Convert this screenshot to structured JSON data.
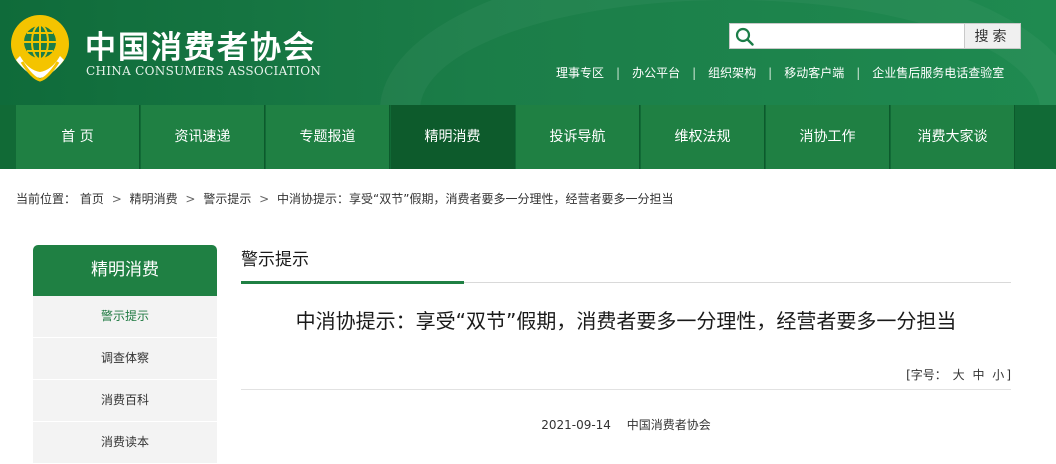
{
  "site": {
    "title": "中国消费者协会",
    "subtitle": "CHINA CONSUMERS ASSOCIATION"
  },
  "search": {
    "placeholder": "",
    "button_label": "搜索"
  },
  "top_links": [
    "理事专区",
    "办公平台",
    "组织架构",
    "移动客户端",
    "企业售后服务电话查验室"
  ],
  "nav": {
    "items": [
      "首 页",
      "资讯速递",
      "专题报道",
      "精明消费",
      "投诉导航",
      "维权法规",
      "消协工作",
      "消费大家谈"
    ],
    "active_index": 3
  },
  "breadcrumb": {
    "prefix": "当前位置：",
    "items": [
      "首页",
      "精明消费",
      "警示提示",
      "中消协提示：享受“双节”假期，消费者要多一分理性，经营者要多一分担当"
    ]
  },
  "sidebar": {
    "title": "精明消费",
    "items": [
      "警示提示",
      "调查体察",
      "消费百科",
      "消费读本"
    ],
    "active_index": 0
  },
  "main": {
    "section_title": "警示提示",
    "article_title": "中消协提示：享受“双节”假期，消费者要多一分理性，经营者要多一分担当",
    "fontsize": {
      "prefix": "[字号：",
      "large": "大",
      "medium": "中",
      "small": "小",
      "suffix": "]"
    },
    "date": "2021-09-14",
    "source": "中国消费者协会"
  },
  "colors": {
    "header_green": "#1b7d48",
    "nav_green": "#1f8043",
    "nav_active": "#0d5b2c"
  }
}
